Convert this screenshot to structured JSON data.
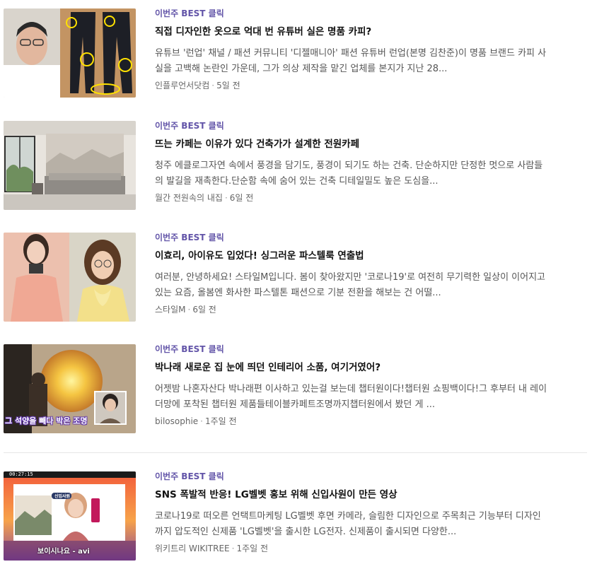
{
  "items": [
    {
      "tag": "이번주 BEST 클릭",
      "title": "직접 디자인한 옷으로 억대 번 유튜버 실은 명품 카피?",
      "description": "유튜브 '런업' 채널 / 패션 커뮤니티 '디젤매니아' 패션 유튜버 런업(본명 김찬준)이 명품 브랜드 카피 사실을 고백해 논란인 가운데, 그가 의상 제작을 맡긴 업체를 본지가 지난 28...",
      "source": "인플루언서닷컴",
      "time": "5일 전"
    },
    {
      "tag": "이번주 BEST 클릭",
      "title": "뜨는 카페는 이유가 있다 건축가가 설계한 전원카페",
      "description": "청주 에클로그자연 속에서 풍경을 담기도, 풍경이 되기도 하는 건축. 단순하지만 단정한 멋으로 사람들의 발길을 재촉한다.단순함 속에 숨어 있는 건축 디테일밀도 높은 도심을...",
      "source": "월간 전원속의 내집",
      "time": "6일 전"
    },
    {
      "tag": "이번주 BEST 클릭",
      "title": "이효리, 아이유도 입었다! 싱그러운 파스텔룩 연출법",
      "description": "여러분, 안녕하세요! 스타일M입니다. 봄이 찾아왔지만 '코로나19'로 여전히 무기력한 일상이 이어지고 있는 요즘, 올봄엔 화사한 파스텔톤 패션으로 기분 전환을 해보는 건 어떨...",
      "source": "스타일M",
      "time": "6일 전"
    },
    {
      "tag": "이번주 BEST 클릭",
      "title": "박나래 새로운 집 눈에 띄던 인테리어 소품, 여기거였어?",
      "description": "어젯밤 나혼자산다 박나래편 이사하고 있는걸 보는데 챕터원이다!챕터원 쇼핑백이다!그 후부터 내 레이더망에 포착된 챕터원 제품들테이블카페트조명까지챕터원에서 봤던 게 ...",
      "source": "bilosophie",
      "time": "1주일 전",
      "thumb_caption": "그 석양을 빼다 박은 조명"
    },
    {
      "tag": "이번주 BEST 클릭",
      "title": "SNS 폭발적 반응! LG벨벳 홍보 위해 신입사원이 만든 영상",
      "description": "코로나19로 떠오른 언택트마케팅 LG벨벳 후면 카메라, 슬림한 디자인으로 주목최근 기능부터 디자인까지 압도적인 신제품 'LG벨벳'을 출시한 LG전자. 신제품이 출시되면 다양한...",
      "source": "위키트리 WIKITREE",
      "time": "1주일 전",
      "thumb_caption": "보이시나요 - avi",
      "thumb_timer": "00:27:15",
      "thumb_badge": "신입사원"
    }
  ],
  "colors": {
    "tag": "#6254a8",
    "title": "#111111",
    "description": "#555555",
    "meta": "#666666",
    "divider": "#e6e6e6"
  }
}
